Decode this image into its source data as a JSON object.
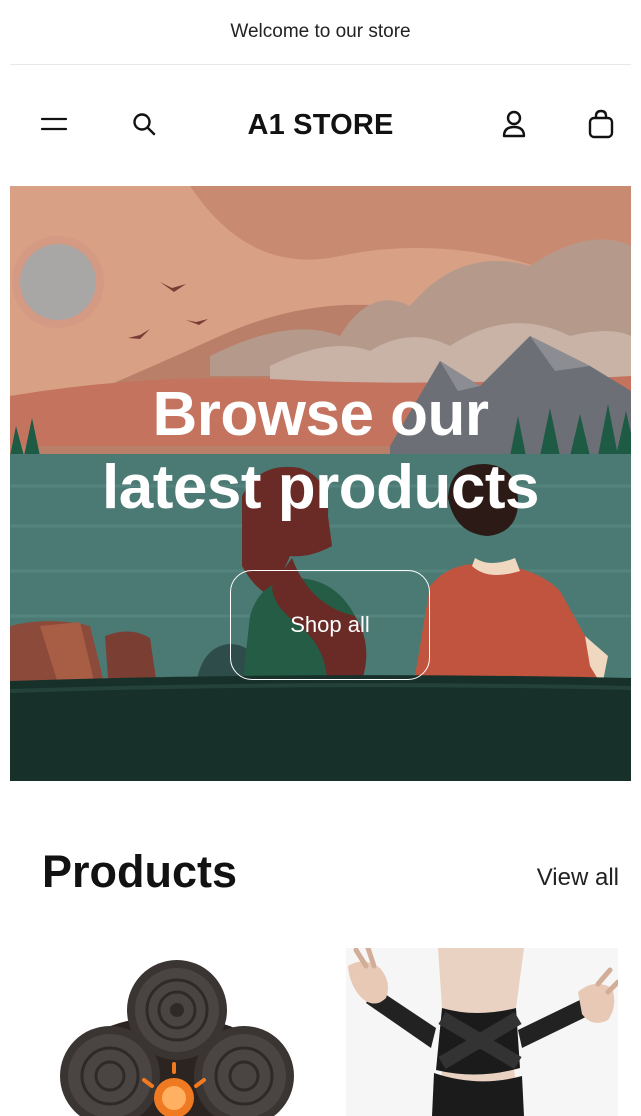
{
  "announcement": {
    "text": "Welcome to our store"
  },
  "header": {
    "menu_icon": "hamburger-menu-icon",
    "search_icon": "search-icon",
    "logo": "A1 STORE",
    "account_icon": "user-account-icon",
    "cart_icon": "shopping-bag-icon"
  },
  "hero": {
    "heading_line1": "Browse our",
    "heading_line2": "latest products",
    "button_label": "Shop all"
  },
  "products_section": {
    "title": "Products",
    "view_all": "View all",
    "items": [
      {
        "image": "massage-gun-product-image"
      },
      {
        "image": "ankle-brace-product-image"
      }
    ]
  }
}
